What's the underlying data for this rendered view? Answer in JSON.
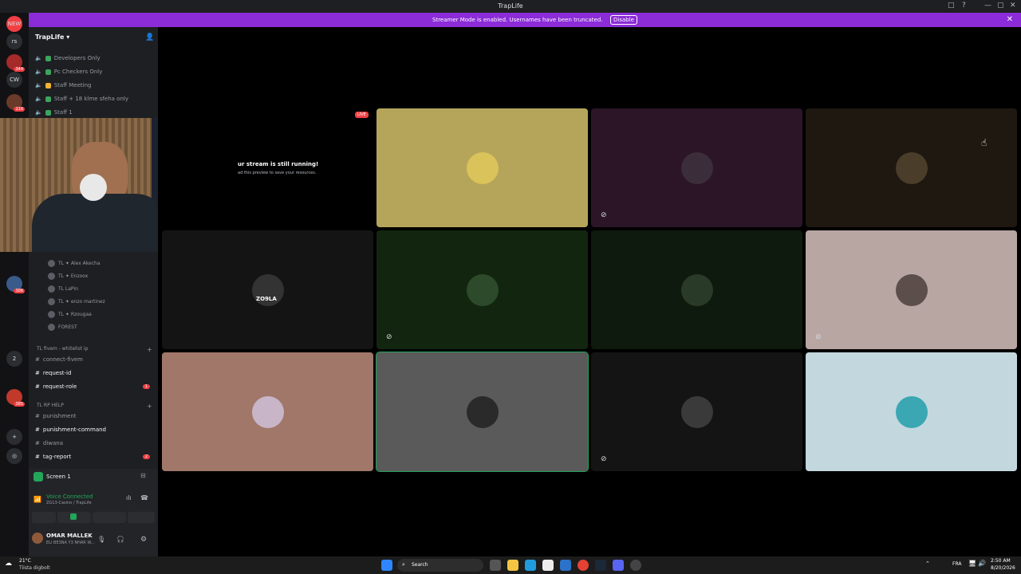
{
  "window": {
    "title": "TrapLife",
    "controls": [
      "□",
      "?",
      "—",
      "▢",
      "✕"
    ]
  },
  "banner": {
    "message": "Streamer Mode is enabled. Usernames have been truncated.",
    "disable_label": "Disable",
    "close": "✕"
  },
  "servers": [
    {
      "label": "NEW"
    },
    {
      "label": "rs"
    },
    {
      "label": "",
      "badge": "344"
    },
    {
      "label": "CW"
    },
    {
      "label": "",
      "badge": "116"
    },
    {
      "label": "",
      "badge": "306"
    },
    {
      "label": "2"
    },
    {
      "label": "",
      "badge": "385"
    },
    {
      "label": "+"
    },
    {
      "label": "◎"
    }
  ],
  "sidebar": {
    "server_name": "TrapLife",
    "top_channels": [
      {
        "name": "Developers Only"
      },
      {
        "name": "Pc Checkers Only"
      },
      {
        "name": "Staff Meeting"
      },
      {
        "name": "Staff + 18 klme sfeha only"
      },
      {
        "name": "Staff 1"
      }
    ],
    "voice_users": [
      {
        "name": "TL ✦ Alex Akecha"
      },
      {
        "name": "TL ✦ Enzoox"
      },
      {
        "name": "TL LaPin"
      },
      {
        "name": "TL ✦ enzo martinez"
      },
      {
        "name": "TL ✦ Rzougaa"
      },
      {
        "name": "FOREST"
      }
    ],
    "category_fivem": "TL fivem - whitelist ip",
    "fivem_channels": [
      {
        "name": "connect-fivem",
        "bright": false
      },
      {
        "name": "request-id",
        "bright": true
      },
      {
        "name": "request-role",
        "bright": true,
        "mention": "1"
      }
    ],
    "category_rp": "TL RP HELP",
    "rp_channels": [
      {
        "name": "punishment",
        "bright": false
      },
      {
        "name": "punishment-command",
        "bright": true
      },
      {
        "name": "diwana",
        "bright": false
      },
      {
        "name": "tag-report",
        "bright": true,
        "mention": "2"
      }
    ]
  },
  "panel": {
    "screen_label": "Screen 1",
    "voice_status": "Voice Connected",
    "voice_channel": "ZG13-Casino / TrapLife",
    "username": "OMAR MALLEK",
    "user_status": "ELI BE3NA Y3 NHAR W..."
  },
  "stage": {
    "live_badge": "LIVE",
    "stream_notice_title": "ur stream is still running!",
    "stream_notice_sub": "ad this preview to save your resources.",
    "tiles": [
      {
        "bg": "#b5a55b",
        "muted": false,
        "avatar": "#d9c35a"
      },
      {
        "bg": "#2b1526",
        "muted": true,
        "avatar": "#3c2d3a"
      },
      {
        "bg": "#1e1810",
        "muted": false,
        "avatar": "#4a3d2a"
      },
      {
        "bg": "#141414",
        "muted": false,
        "avatar": "#333",
        "tag": "ZO9LA"
      },
      {
        "bg": "#12260f",
        "muted": true,
        "avatar": "#2d4a2a"
      },
      {
        "bg": "#0e1a0d",
        "muted": false,
        "avatar": "#2a3a28"
      },
      {
        "bg": "#b8a6a3",
        "muted": true,
        "avatar": "#5c4e4b"
      },
      {
        "bg": "#a1776a",
        "muted": false,
        "avatar": "#c9b5c8"
      },
      {
        "bg": "#5a5a5a",
        "muted": false,
        "avatar": "#2a2a2a"
      },
      {
        "bg": "#141414",
        "muted": true,
        "avatar": "#3a3a3a"
      },
      {
        "bg": "#c3d8de",
        "muted": false,
        "avatar": "#3aa7b3"
      }
    ]
  },
  "taskbar": {
    "weather_temp": "21°C",
    "weather_desc": "Tiista digbolt",
    "search_label": "Search",
    "lang": "FRA",
    "time": "2:50 AM",
    "date": "8/20/2026"
  },
  "colors": {
    "accent": "#8c2bd8",
    "live": "#f23f43",
    "connected": "#23a55a"
  }
}
